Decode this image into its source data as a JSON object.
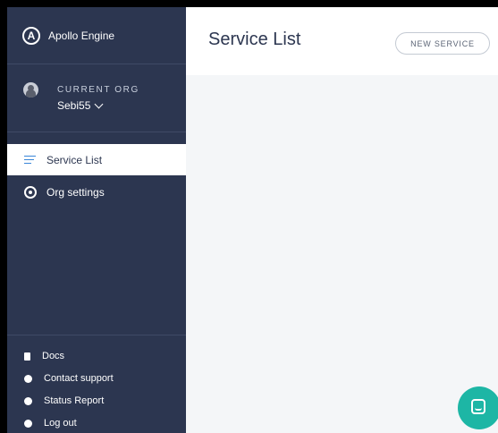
{
  "brand": {
    "logo_letter": "A",
    "name": "Apollo Engine"
  },
  "org": {
    "label": "CURRENT ORG",
    "name": "Sebi55"
  },
  "nav": {
    "items": [
      {
        "label": "Service List",
        "icon": "list-icon",
        "active": true
      },
      {
        "label": "Org settings",
        "icon": "gear-icon",
        "active": false
      }
    ]
  },
  "footer": {
    "items": [
      {
        "label": "Docs",
        "icon": "document-icon"
      },
      {
        "label": "Contact support",
        "icon": "lifebuoy-icon"
      },
      {
        "label": "Status Report",
        "icon": "smiley-icon"
      },
      {
        "label": "Log out",
        "icon": "logout-icon"
      }
    ]
  },
  "main": {
    "title": "Service List",
    "new_button_label": "NEW SERVICE"
  },
  "colors": {
    "sidebar": "#2c3650",
    "accent": "#3a86d8",
    "chat": "#1db6a5"
  }
}
